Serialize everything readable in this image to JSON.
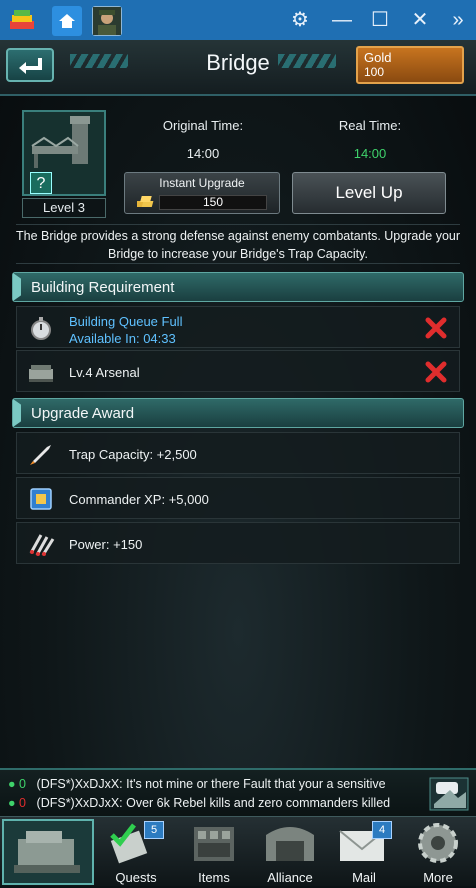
{
  "colors": {
    "titlebar": "#1f6fb3",
    "accent": "#3fd26b",
    "gold": "#c7741f",
    "error": "#e02d2d",
    "link": "#5fc1ff"
  },
  "titlebar": {
    "icons": [
      "bluestacks-logo-icon",
      "home-icon",
      "game-thumb",
      "gear-icon",
      "minimize-icon",
      "maximize-icon",
      "close-icon",
      "expand-icon"
    ]
  },
  "header": {
    "title": "Bridge",
    "gold_label": "Gold",
    "gold_value": "100"
  },
  "building": {
    "level": "Level 3",
    "original_time_label": "Original Time:",
    "original_time": "14:00",
    "real_time_label": "Real Time:",
    "real_time": "14:00",
    "instant_upgrade_label": "Instant Upgrade",
    "instant_cost": "150",
    "level_up_label": "Level Up",
    "description": "The Bridge provides a strong defense against enemy combatants. Upgrade your Bridge to increase your Bridge's Trap Capacity."
  },
  "requirements": {
    "title": "Building Requirement",
    "queue_title": "Building Queue Full",
    "queue_available": "Available In: 04:33",
    "arsenal": "Lv.4 Arsenal"
  },
  "awards": {
    "title": "Upgrade Award",
    "items": [
      "Trap Capacity: +2,500",
      "Commander XP: +5,000",
      "Power: +150"
    ]
  },
  "chat": {
    "lines": [
      {
        "count": "0",
        "text": "(DFS*)XxDJxX: It's not mine or there Fault that your a sensitive"
      },
      {
        "count": "0",
        "text": "(DFS*)XxDJxX: Over 6k Rebel kills and zero commanders killed"
      }
    ]
  },
  "nav": {
    "quests": "Quests",
    "quests_badge": "5",
    "items": "Items",
    "alliance": "Alliance",
    "mail": "Mail",
    "mail_badge": "4",
    "more": "More"
  }
}
